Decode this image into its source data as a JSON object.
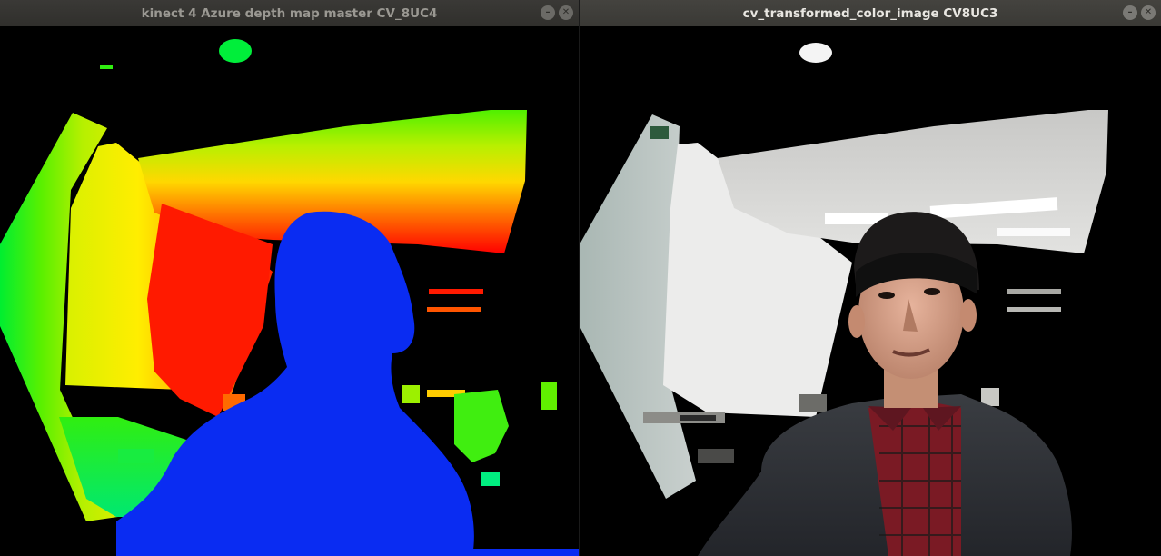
{
  "windows": [
    {
      "title": "kinect 4 Azure depth map master CV_8UC4",
      "state": "inactive",
      "controls": {
        "minimize_glyph": "–",
        "close_glyph": "✕"
      },
      "content_icon": "depth-map-image"
    },
    {
      "title": "cv_transformed_color_image CV8UC3",
      "state": "active",
      "controls": {
        "minimize_glyph": "–",
        "close_glyph": "✕"
      },
      "content_icon": "color-camera-image"
    }
  ],
  "colors": {
    "titlebar_inactive": "#34332f",
    "titlebar_active": "#3e3d39",
    "depth_person": "#0a2cf2",
    "background": "#000000"
  }
}
